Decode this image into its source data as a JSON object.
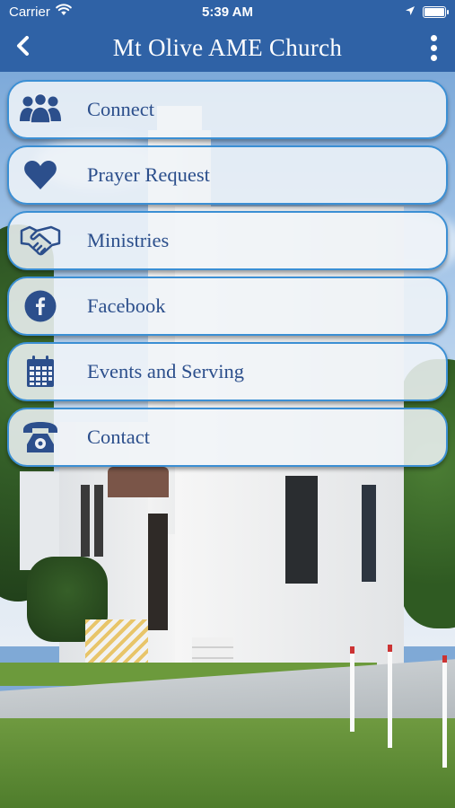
{
  "status_bar": {
    "carrier": "Carrier",
    "time": "5:39 AM",
    "icons": [
      "wifi-icon",
      "location-arrow-icon",
      "battery-icon"
    ],
    "battery_level": 1.0
  },
  "nav": {
    "title": "Mt Olive AME Church",
    "back_icon": "chevron-left-icon",
    "more_icon": "more-vertical-icon"
  },
  "menu": {
    "items": [
      {
        "label": "Connect",
        "icon": "people-group-icon"
      },
      {
        "label": "Prayer Request",
        "icon": "heart-icon"
      },
      {
        "label": "Ministries",
        "icon": "handshake-icon"
      },
      {
        "label": "Facebook",
        "icon": "facebook-icon"
      },
      {
        "label": "Events and Serving",
        "icon": "calendar-icon"
      },
      {
        "label": "Contact",
        "icon": "telephone-icon"
      }
    ]
  },
  "colors": {
    "bar": "#2f62a6",
    "item_text": "#2c4f8c",
    "item_border": "#3b8fd4",
    "icon": "#2c4f8c"
  }
}
